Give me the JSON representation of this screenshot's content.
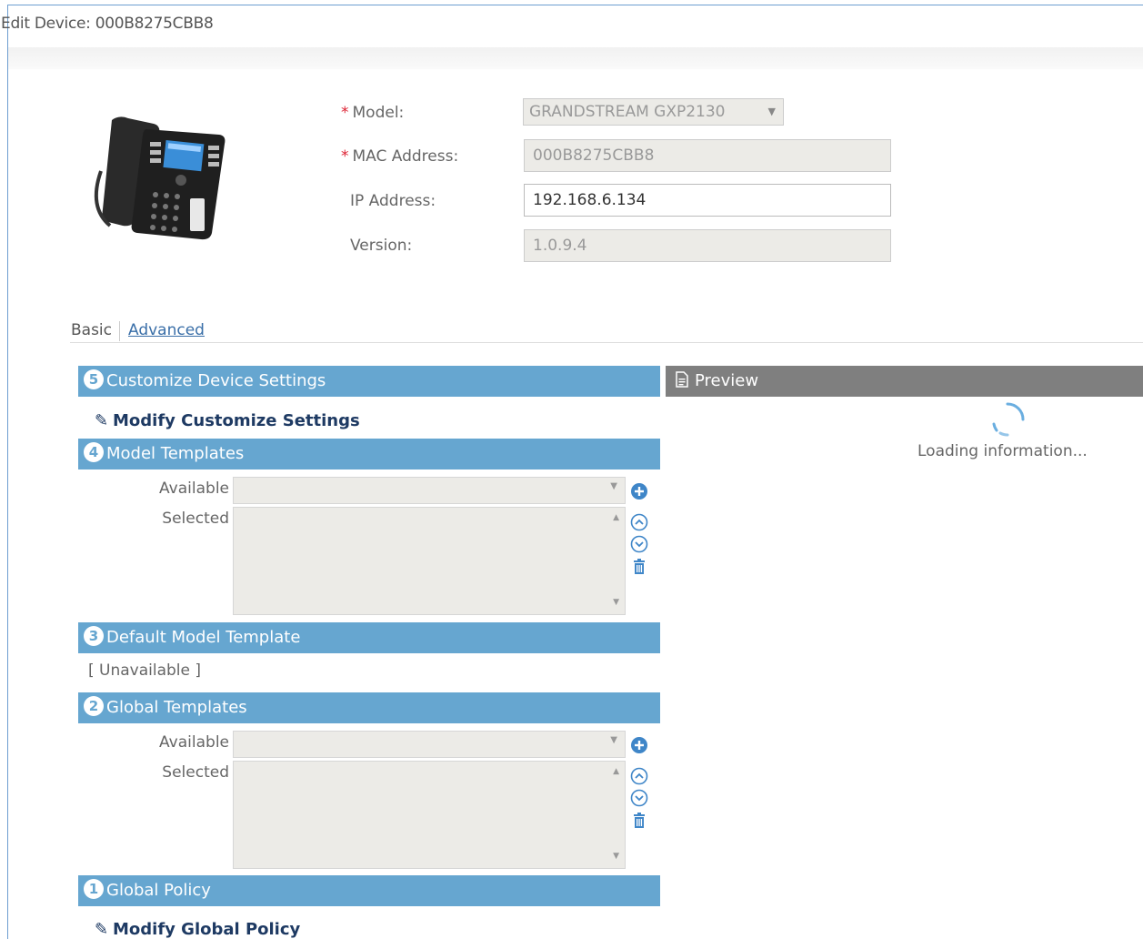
{
  "window": {
    "title": "Edit Device: 000B8275CBB8"
  },
  "device": {
    "model_label": "Model:",
    "model_value": "GRANDSTREAM GXP2130",
    "mac_label": "MAC Address:",
    "mac_value": "000B8275CBB8",
    "ip_label": "IP Address:",
    "ip_value": "192.168.6.134",
    "version_label": "Version:",
    "version_value": "1.0.9.4",
    "required_mark": "*"
  },
  "tabs": [
    {
      "label": "Basic",
      "active": false
    },
    {
      "label": "Advanced",
      "active": true
    }
  ],
  "sections": {
    "customize": {
      "num": "5",
      "title": "Customize Device Settings",
      "link": "Modify Customize Settings"
    },
    "model_templates": {
      "num": "4",
      "title": "Model Templates",
      "available_label": "Available",
      "selected_label": "Selected"
    },
    "default_model": {
      "num": "3",
      "title": "Default Model Template",
      "value": "[ Unavailable ]"
    },
    "global_templates": {
      "num": "2",
      "title": "Global Templates",
      "available_label": "Available",
      "selected_label": "Selected"
    },
    "global_policy": {
      "num": "1",
      "title": "Global Policy",
      "link": "Modify Global Policy"
    }
  },
  "preview": {
    "title": "Preview",
    "loading": "Loading information..."
  },
  "icons": {
    "add": "plus-circle-icon",
    "up": "arrow-up-circle-icon",
    "down": "arrow-down-circle-icon",
    "delete": "trash-icon",
    "edit": "pencil-icon",
    "preview": "document-icon"
  },
  "colors": {
    "section": "#66a6d0",
    "preview": "#7f7f7f",
    "link": "#1e3a63",
    "required": "#dd2233",
    "tab_active": "#3a6fa8"
  }
}
